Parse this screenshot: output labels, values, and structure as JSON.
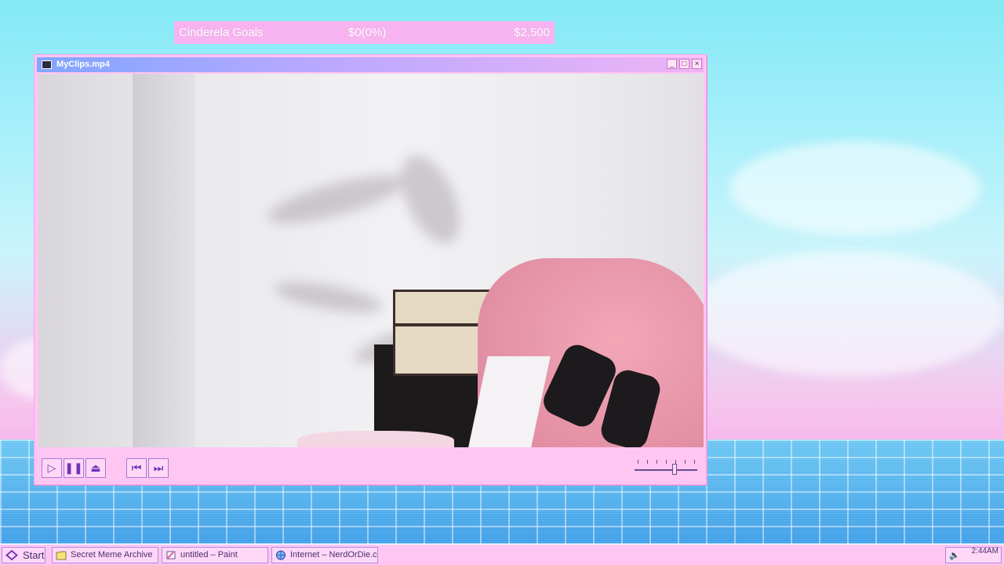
{
  "goal_bar": {
    "title": "Cinderela Goals",
    "progress": "$0(0%)",
    "target": "$2,500"
  },
  "window": {
    "title": "MyClips.mp4",
    "icon": "monitor-icon",
    "buttons": {
      "minimize": "minimize-icon",
      "maximize": "maximize-icon",
      "close": "close-icon"
    }
  },
  "player": {
    "controls": [
      "play-icon",
      "pause-icon",
      "eject-icon",
      "skip-back-icon",
      "skip-forward-icon"
    ],
    "volume_level": 0.65
  },
  "taskbar": {
    "start_label": "Start",
    "items": [
      {
        "label": "Secret Meme Archive",
        "icon": "folder-icon"
      },
      {
        "label": "untitled – Paint",
        "icon": "paint-icon"
      },
      {
        "label": "Internet – NerdOrDie.com",
        "icon": "globe-icon"
      }
    ],
    "clock": "2:44AM"
  },
  "colors": {
    "window_bg": "#ffc6f3",
    "titlebar_start": "#7fa6ff",
    "titlebar_end": "#eeb4f5",
    "control_accent": "#6f35b5"
  }
}
